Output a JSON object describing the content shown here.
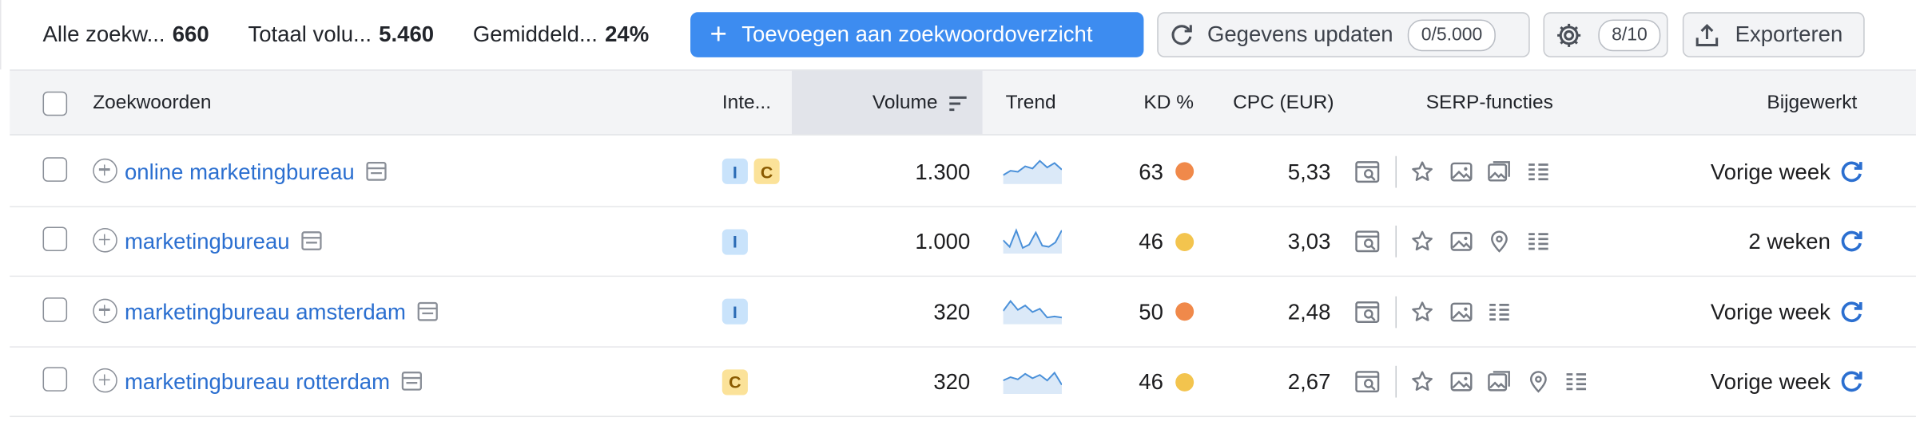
{
  "toolbar": {
    "stats": [
      {
        "label": "Alle zoekw...",
        "value": "660"
      },
      {
        "label": "Totaal volu...",
        "value": "5.460"
      },
      {
        "label": "Gemiddeld...",
        "value": "24%"
      }
    ],
    "add_button": "Toevoegen aan zoekwoordoverzicht",
    "update_button": "Gegevens updaten",
    "update_count": "0/5.000",
    "settings_count": "8/10",
    "export_button": "Exporteren"
  },
  "columns": {
    "keywords": "Zoekwoorden",
    "intent": "Inte...",
    "volume": "Volume",
    "trend": "Trend",
    "kd": "KD %",
    "cpc": "CPC (EUR)",
    "serp": "SERP-functies",
    "updated": "Bijgewerkt"
  },
  "rows": [
    {
      "keyword": "online marketingbureau",
      "intents": [
        "I",
        "C"
      ],
      "volume": "1.300",
      "trend": [
        0.3,
        0.5,
        0.45,
        0.7,
        0.6,
        0.95,
        0.65,
        0.85,
        0.55
      ],
      "kd": "63",
      "kd_color": "#f0894a",
      "cpc": "5,33",
      "serp": [
        "star-icon",
        "image-icon",
        "image-pack-icon",
        "list-icon"
      ],
      "updated": "Vorige week"
    },
    {
      "keyword": "marketingbureau",
      "intents": [
        "I"
      ],
      "volume": "1.000",
      "trend": [
        0.5,
        0.2,
        0.95,
        0.15,
        0.3,
        0.85,
        0.25,
        0.2,
        0.4,
        0.95
      ],
      "kd": "46",
      "kd_color": "#f3c44e",
      "cpc": "3,03",
      "serp": [
        "star-icon",
        "image-icon",
        "local-pack-icon",
        "list-icon"
      ],
      "updated": "2 weken"
    },
    {
      "keyword": "marketingbureau amsterdam",
      "intents": [
        "I"
      ],
      "volume": "320",
      "trend": [
        0.5,
        0.95,
        0.55,
        0.75,
        0.45,
        0.6,
        0.2,
        0.25,
        0.2
      ],
      "kd": "50",
      "kd_color": "#f0894a",
      "cpc": "2,48",
      "serp": [
        "star-icon",
        "image-icon",
        "list-icon"
      ],
      "updated": "Vorige week"
    },
    {
      "keyword": "marketingbureau rotterdam",
      "intents": [
        "C"
      ],
      "volume": "320",
      "trend": [
        0.5,
        0.65,
        0.55,
        0.8,
        0.6,
        0.75,
        0.5,
        0.85,
        0.3
      ],
      "kd": "46",
      "kd_color": "#f3c44e",
      "cpc": "2,67",
      "serp": [
        "star-icon",
        "image-icon",
        "image-pack-icon",
        "local-pack-icon",
        "list-icon"
      ],
      "updated": "Vorige week"
    }
  ],
  "colors": {
    "primary": "#3d8cf0",
    "link": "#2b6fd0",
    "trend_line": "#4a90d9",
    "trend_fill": "#dbe9f8"
  }
}
